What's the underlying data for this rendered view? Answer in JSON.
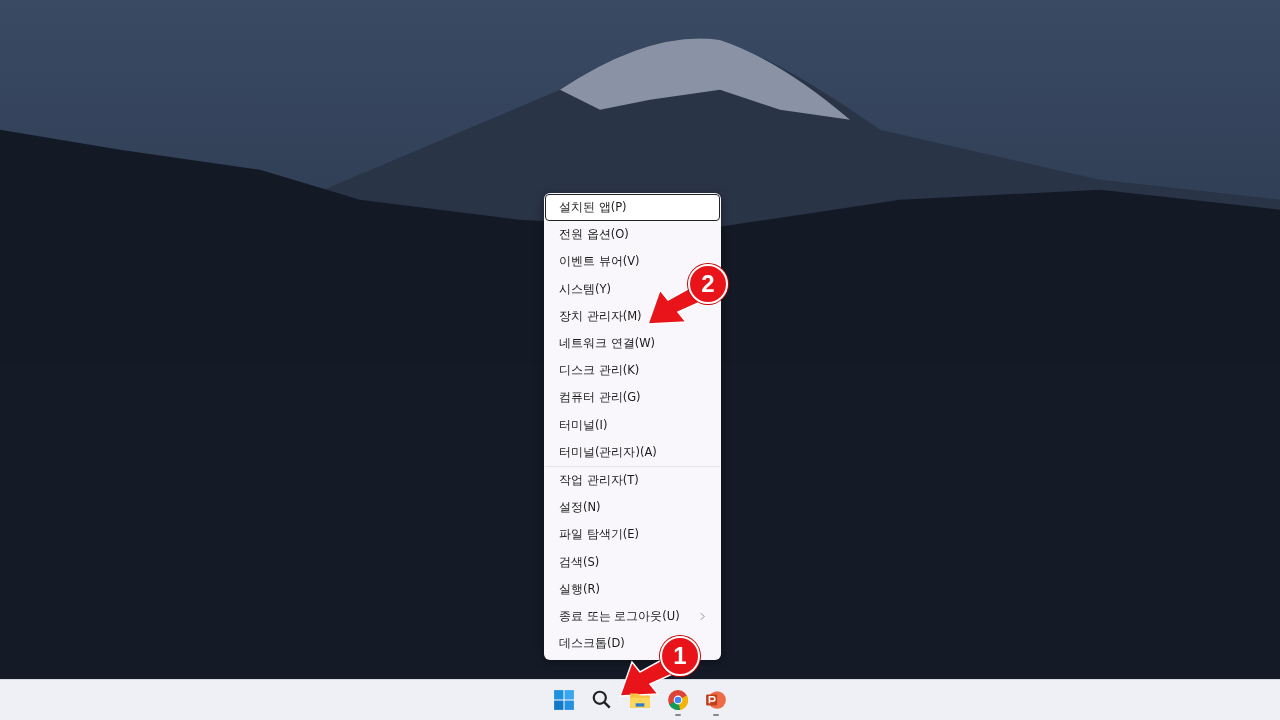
{
  "menu": {
    "groups": [
      {
        "items": [
          {
            "label": "설치된 앱(P)",
            "selected": true,
            "has_submenu": false
          },
          {
            "label": "전원 옵션(O)",
            "selected": false,
            "has_submenu": false
          },
          {
            "label": "이벤트 뷰어(V)",
            "selected": false,
            "has_submenu": false
          },
          {
            "label": "시스템(Y)",
            "selected": false,
            "has_submenu": false
          },
          {
            "label": "장치 관리자(M)",
            "selected": false,
            "has_submenu": false
          },
          {
            "label": "네트워크 연결(W)",
            "selected": false,
            "has_submenu": false
          },
          {
            "label": "디스크 관리(K)",
            "selected": false,
            "has_submenu": false
          },
          {
            "label": "컴퓨터 관리(G)",
            "selected": false,
            "has_submenu": false
          },
          {
            "label": "터미널(I)",
            "selected": false,
            "has_submenu": false
          },
          {
            "label": "터미널(관리자)(A)",
            "selected": false,
            "has_submenu": false
          }
        ]
      },
      {
        "items": [
          {
            "label": "작업 관리자(T)",
            "selected": false,
            "has_submenu": false
          },
          {
            "label": "설정(N)",
            "selected": false,
            "has_submenu": false
          },
          {
            "label": "파일 탐색기(E)",
            "selected": false,
            "has_submenu": false
          },
          {
            "label": "검색(S)",
            "selected": false,
            "has_submenu": false
          },
          {
            "label": "실행(R)",
            "selected": false,
            "has_submenu": false
          },
          {
            "label": "종료 또는 로그아웃(U)",
            "selected": false,
            "has_submenu": true
          },
          {
            "label": "데스크톱(D)",
            "selected": false,
            "has_submenu": false
          }
        ]
      }
    ]
  },
  "taskbar": {
    "icons": [
      {
        "kind": "start",
        "running": false
      },
      {
        "kind": "search",
        "running": false
      },
      {
        "kind": "folder",
        "running": false
      },
      {
        "kind": "browser",
        "running": true
      },
      {
        "kind": "slides",
        "running": true
      }
    ]
  },
  "callouts": [
    {
      "number": "2"
    },
    {
      "number": "1"
    }
  ]
}
